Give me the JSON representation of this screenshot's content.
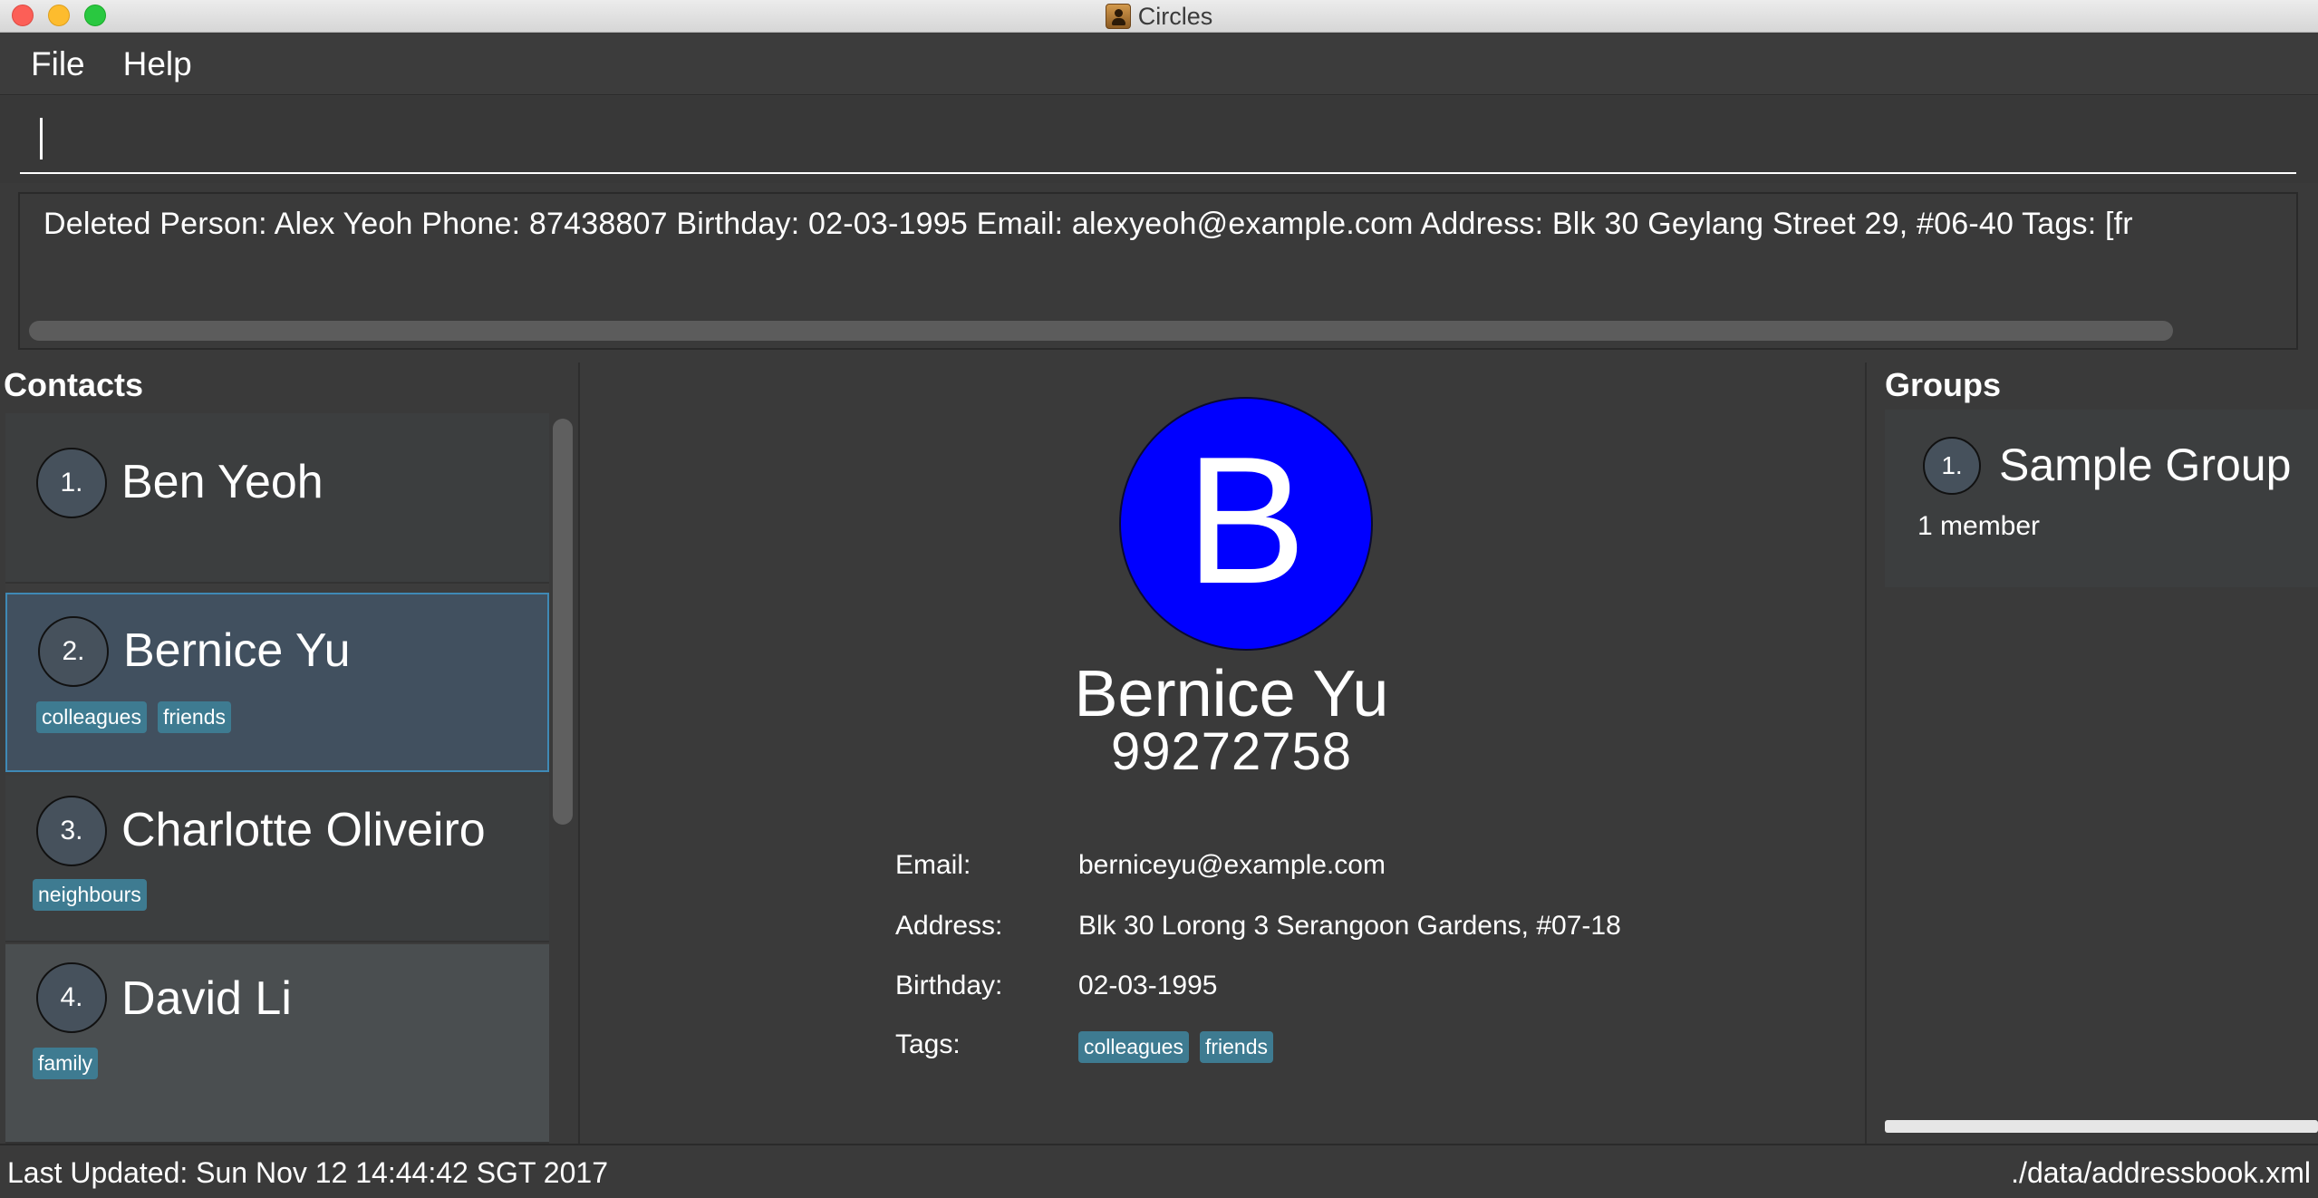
{
  "window": {
    "title": "Circles"
  },
  "menu": {
    "items": [
      "File",
      "Help"
    ]
  },
  "command_box": {
    "value": "",
    "placeholder": ""
  },
  "result_display": {
    "text": "Deleted Person: Alex Yeoh Phone: 87438807 Birthday: 02-03-1995 Email: alexyeoh@example.com Address: Blk 30 Geylang Street 29, #06-40 Tags: [fr"
  },
  "contacts": {
    "title": "Contacts",
    "items": [
      {
        "index": "1.",
        "name": "Ben Yeoh",
        "tags": []
      },
      {
        "index": "2.",
        "name": "Bernice Yu",
        "tags": [
          "colleagues",
          "friends"
        ]
      },
      {
        "index": "3.",
        "name": "Charlotte Oliveiro",
        "tags": [
          "neighbours"
        ]
      },
      {
        "index": "4.",
        "name": "David Li",
        "tags": [
          "family"
        ]
      }
    ]
  },
  "detail": {
    "avatar_letter": "B",
    "avatar_color": "#0000ff",
    "name": "Bernice Yu",
    "phone": "99272758",
    "labels": {
      "email": "Email:",
      "address": "Address:",
      "birthday": "Birthday:",
      "tags": "Tags:"
    },
    "email": "berniceyu@example.com",
    "address": "Blk 30 Lorong 3 Serangoon Gardens, #07-18",
    "birthday": "02-03-1995",
    "tags": [
      "colleagues",
      "friends"
    ]
  },
  "groups": {
    "title": "Groups",
    "items": [
      {
        "index": "1.",
        "name": "Sample Group",
        "members": "1 member"
      }
    ]
  },
  "status": {
    "last_updated": "Last Updated: Sun Nov 12 14:44:42 SGT 2017",
    "file_path": "./data/addressbook.xml"
  },
  "colors": {
    "tag": "#3e7b91",
    "selection_border": "#3f89b5",
    "background": "#3a3a3a"
  }
}
